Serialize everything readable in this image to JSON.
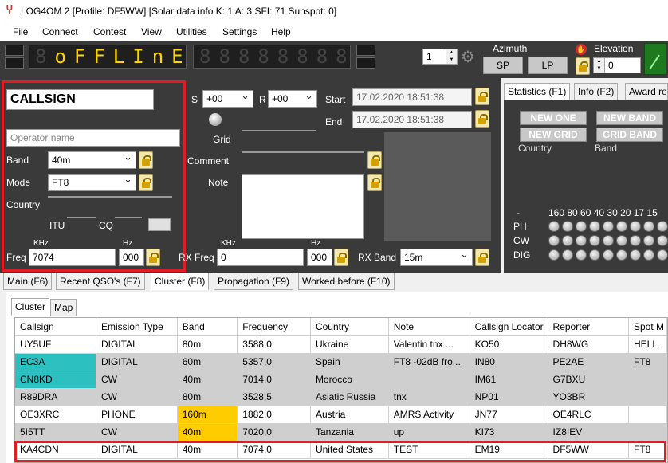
{
  "window": {
    "title": "LOG4OM 2 [Profile: DF5WW] [Solar data info K: 1 A: 3 SFI: 71 Sunspot: 0]"
  },
  "menu": [
    "File",
    "Connect",
    "Contest",
    "View",
    "Utilities",
    "Settings",
    "Help"
  ],
  "topbar": {
    "display": "oFFLInE",
    "spin_value": "1",
    "azimuth_label": "Azimuth",
    "sp_label": "SP",
    "lp_label": "LP",
    "elevation_label": "Elevation",
    "elevation_value": "0"
  },
  "qso": {
    "callsign": "CALLSIGN",
    "operator_placeholder": "Operator name",
    "band_label": "Band",
    "band_value": "40m",
    "mode_label": "Mode",
    "mode_value": "FT8",
    "country_label": "Country",
    "country_value": "",
    "itu_label": "ITU",
    "cq_label": "CQ",
    "khz_label": "KHz",
    "hz_label": "Hz",
    "freq_label": "Freq",
    "freq_value": "7074",
    "freq_hz": "000",
    "s_label": "S",
    "s_value": "+00",
    "r_label": "R",
    "r_value": "+00",
    "start_label": "Start",
    "start_value": "17.02.2020 18:51:38",
    "end_label": "End",
    "end_value": "17.02.2020 18:51:38",
    "grid_label": "Grid",
    "comment_label": "Comment",
    "note_label": "Note",
    "rx_khz_label": "KHz",
    "rx_hz_label": "Hz",
    "rx_freq_label": "RX Freq",
    "rx_freq_value": "0",
    "rx_freq_hz": "000",
    "rx_band_label": "RX Band",
    "rx_band_value": "15m"
  },
  "stats": {
    "tabs": [
      "Statistics (F1)",
      "Info (F2)",
      "Award re"
    ],
    "new_one": "NEW ONE",
    "new_band": "NEW BAND",
    "new_grid": "NEW GRID",
    "grid_band": "GRID BAND",
    "country_label": "Country",
    "band_label": "Band",
    "dash": "-",
    "bands_header": "160 80 60 40 30 20 17 15",
    "rows": [
      "PH",
      "CW",
      "DIG"
    ]
  },
  "bottom_tabs": [
    "Main (F6)",
    "Recent QSO's (F7)",
    "Cluster (F8)",
    "Propagation (F9)",
    "Worked before (F10)"
  ],
  "sub_tabs": [
    "Cluster",
    "Map"
  ],
  "cluster": {
    "headers": [
      "Callsign",
      "Emission Type",
      "Band",
      "Frequency",
      "Country",
      "Note",
      "Callsign Locator",
      "Reporter",
      "Spot M"
    ],
    "rows": [
      [
        "UY5UF",
        "DIGITAL",
        "80m",
        "3588,0",
        "Ukraine",
        "Valentin  tnx ...",
        "KO50",
        "DH8WG",
        "HELL"
      ],
      [
        "EC3A",
        "DIGITAL",
        "60m",
        "5357,0",
        "Spain",
        "FT8 -02dB fro...",
        "IN80",
        "PE2AE",
        "FT8"
      ],
      [
        "CN8KD",
        "CW",
        "40m",
        "7014,0",
        "Morocco",
        "",
        "IM61",
        "G7BXU",
        ""
      ],
      [
        "R89DRA",
        "CW",
        "80m",
        "3528,5",
        "Asiatic Russia",
        "tnx",
        "NP01",
        "YO3BR",
        ""
      ],
      [
        "OE3XRC",
        "PHONE",
        "160m",
        "1882,0",
        "Austria",
        "AMRS Activity",
        "JN77",
        "OE4RLC",
        ""
      ],
      [
        "5I5TT",
        "CW",
        "40m",
        "7020,0",
        "Tanzania",
        "up",
        "KI73",
        "IZ8IEV",
        ""
      ],
      [
        "KA4CDN",
        "DIGITAL",
        "40m",
        "7074,0",
        "United States",
        "TEST",
        "EM19",
        "DF5WW",
        "FT8"
      ]
    ]
  }
}
